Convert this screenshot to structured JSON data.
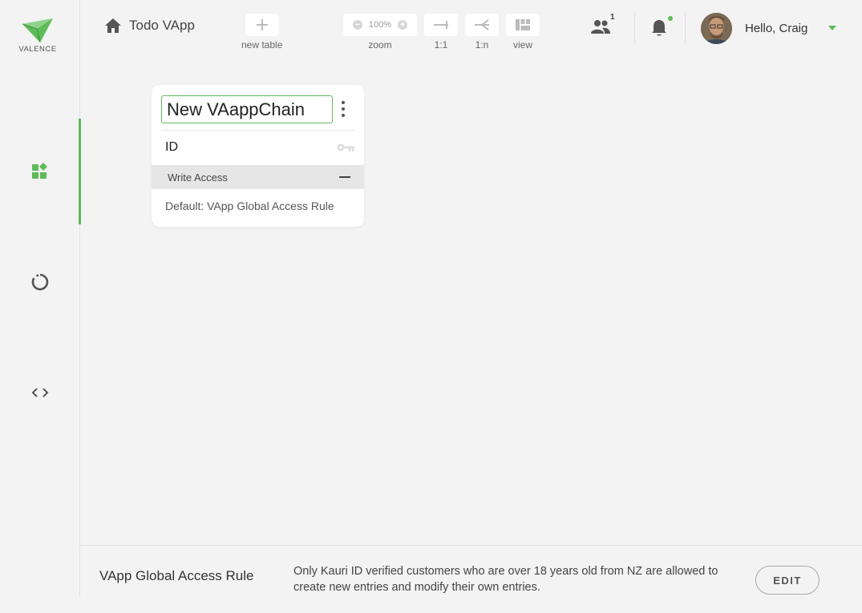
{
  "brand": {
    "name": "VALENCE",
    "accent": "#5fba5a"
  },
  "header": {
    "home_icon": "home-icon",
    "app_title": "Todo VApp",
    "toolbar": {
      "new_table": {
        "label": "new table",
        "icon": "plus-icon"
      },
      "zoom": {
        "label": "zoom",
        "value": "100%"
      },
      "one_to_one": {
        "label": "1:1",
        "icon": "relation-1-1-icon"
      },
      "one_to_many": {
        "label": "1:n",
        "icon": "relation-1-n-icon"
      },
      "view": {
        "label": "view",
        "icon": "layout-view-icon"
      }
    },
    "collaborators_count": "1",
    "user": {
      "greeting": "Hello, Craig"
    }
  },
  "sidebar": {
    "items": [
      {
        "icon": "dashboard-icon",
        "active": true
      },
      {
        "icon": "loading-circle-icon",
        "active": false
      },
      {
        "icon": "code-icon",
        "active": false
      }
    ]
  },
  "table_card": {
    "name": "New VAappChain",
    "field": "ID",
    "field_icon": "key-icon",
    "section_label": "Write Access",
    "rule": "Default: VApp Global Access Rule"
  },
  "footer": {
    "title": "VApp Global Access Rule",
    "description": "Only Kauri ID verified customers who are over 18 years old from NZ are allowed to create new entries and modify their own entries.",
    "edit_label": "EDIT"
  }
}
